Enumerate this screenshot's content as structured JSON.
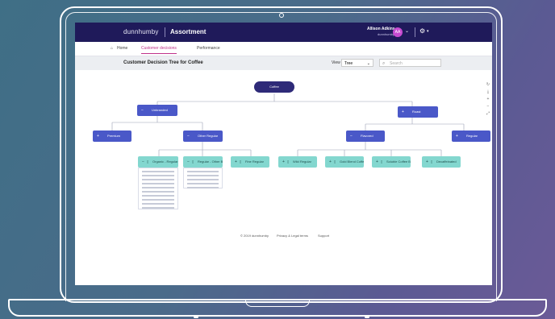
{
  "header": {
    "brand": "dunnhumby",
    "app_name": "Assortment",
    "user_name": "Allison Adkins",
    "user_org": "dunnhumby",
    "avatar_initials": "AA"
  },
  "tabs": [
    {
      "label": "Home"
    },
    {
      "label": "Customer decisions"
    },
    {
      "label": "Performance"
    }
  ],
  "page": {
    "title": "Customer Decision Tree for Coffee",
    "view_label": "View",
    "view_value": "Tree",
    "search_placeholder": "Search"
  },
  "tree": {
    "root": "Coffee",
    "level1": [
      "Unbranded",
      "Roast"
    ],
    "level2": [
      "Premium",
      "Other Regular",
      "Flavored",
      "Regular"
    ],
    "level3": [
      "Organic - Regular",
      "Regular - Other Brands",
      "Fine Regular",
      "Wild Regular",
      "Gold Blend Coffee",
      "Soluble Coffee Blend",
      "Decaffeinated"
    ]
  },
  "footer": {
    "copyright": "© 2019 dunnhumby",
    "privacy": "Privacy & Legal terms",
    "support": "Support"
  },
  "colors": {
    "header_bg": "#1f1a5a",
    "accent": "#c0318a",
    "node_dark": "#2e2a78",
    "node_blue": "#4a58c8",
    "node_teal": "#83d7cf"
  }
}
